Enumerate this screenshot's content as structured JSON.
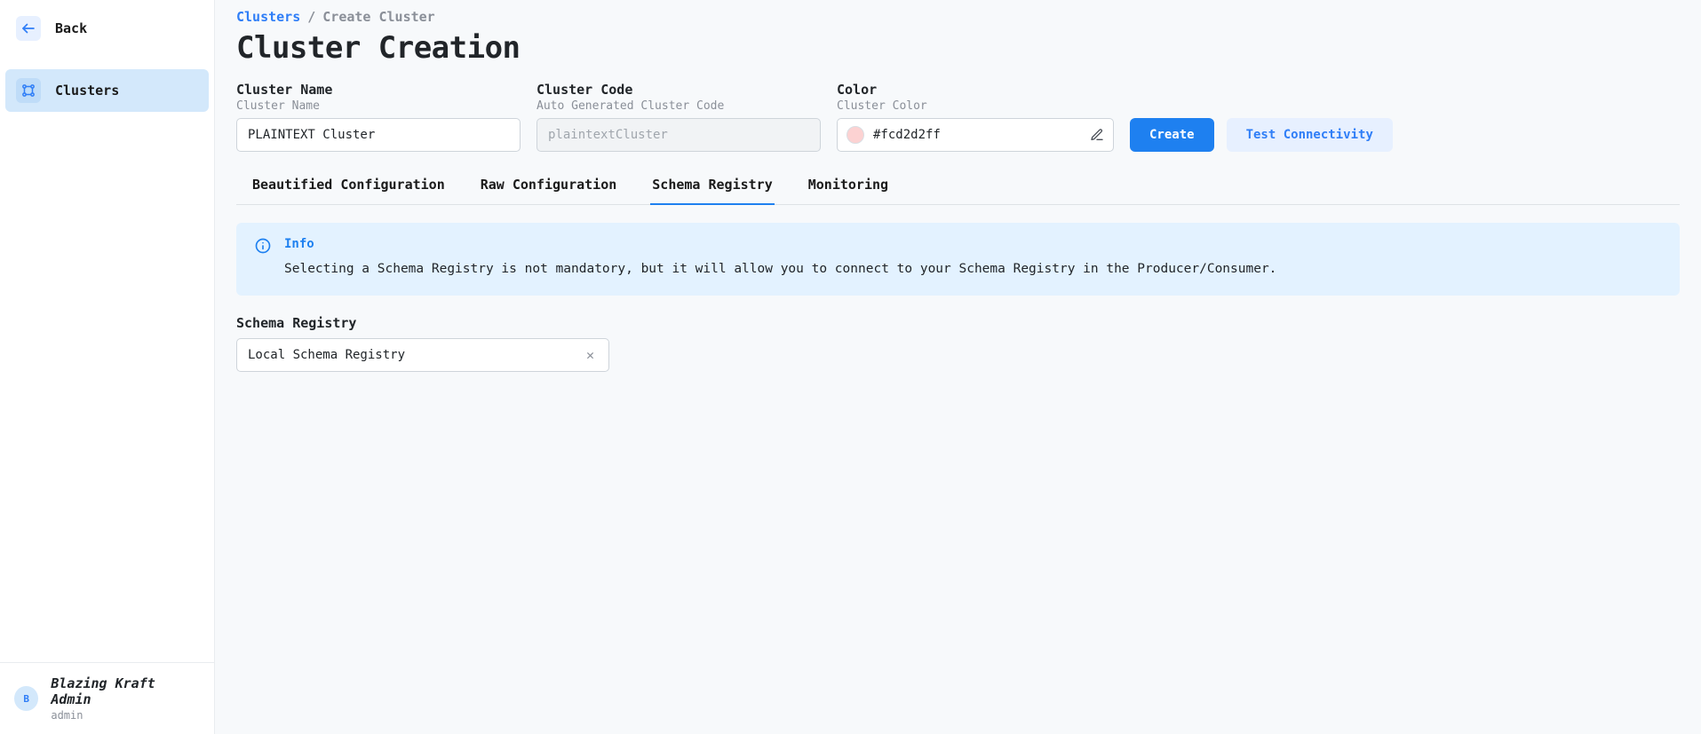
{
  "sidebar": {
    "back_label": "Back",
    "nav": [
      {
        "label": "Clusters",
        "active": true
      }
    ],
    "user": {
      "avatar_initial": "B",
      "name": "Blazing Kraft Admin",
      "role": "admin"
    }
  },
  "breadcrumb": {
    "root": "Clusters",
    "sep": "/",
    "current": "Create Cluster"
  },
  "page_title": "Cluster Creation",
  "fields": {
    "name": {
      "label": "Cluster Name",
      "sub": "Cluster Name",
      "value": "PLAINTEXT Cluster"
    },
    "code": {
      "label": "Cluster Code",
      "sub": "Auto Generated Cluster Code",
      "value": "plaintextCluster"
    },
    "color": {
      "label": "Color",
      "sub": "Cluster Color",
      "value": "#fcd2d2ff",
      "swatch": "#fcd2d2"
    }
  },
  "actions": {
    "create": "Create",
    "test": "Test Connectivity"
  },
  "tabs": [
    {
      "label": "Beautified Configuration",
      "active": false
    },
    {
      "label": "Raw Configuration",
      "active": false
    },
    {
      "label": "Schema Registry",
      "active": true
    },
    {
      "label": "Monitoring",
      "active": false
    }
  ],
  "info": {
    "title": "Info",
    "text": "Selecting a Schema Registry is not mandatory, but it will allow you to connect to your Schema Registry in the Producer/Consumer."
  },
  "schema_registry": {
    "label": "Schema Registry",
    "value": "Local Schema Registry"
  }
}
